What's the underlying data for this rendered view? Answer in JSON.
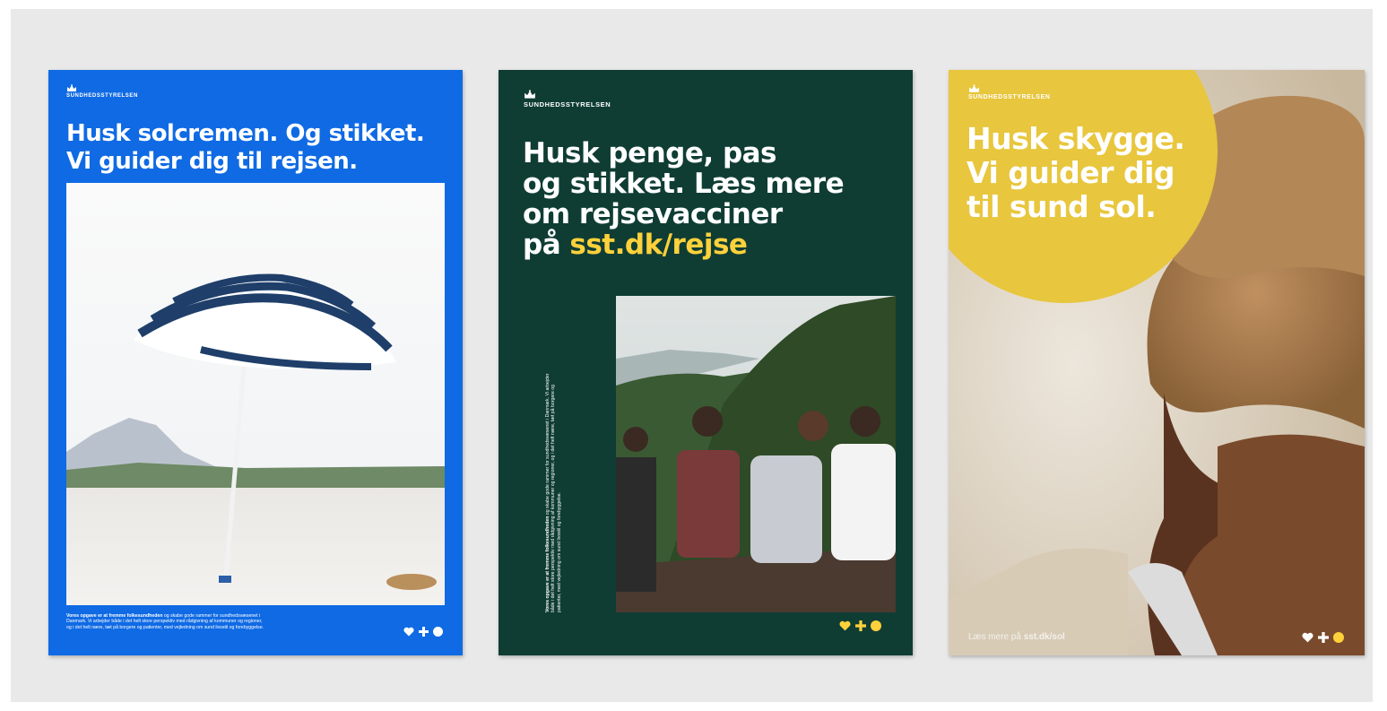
{
  "brand": {
    "name": "SUNDHEDSSTYRELSEN"
  },
  "colors": {
    "stage_bg": "#e9e9e9",
    "poster1_bg": "#0f6ae4",
    "poster2_bg": "#0f3d34",
    "accent_yellow": "#ffd13b",
    "sun_circle": "#e8c63d"
  },
  "posters": [
    {
      "headline": [
        "Husk solcremen. Og stikket.",
        "Vi guider dig til rejsen."
      ],
      "photo": "beach-umbrella-photo",
      "footer_bold": "Vores opgave er at fremme folkesundheden",
      "footer_rest": " og skabe gode rammer for sundhedsvæsenet i Danmark. Vi arbejder både i det helt store perspektiv med rådgivning af kommuner og regioner, og i det helt nære, tæt på borgere og patienter, med vejledning om sund livsstil og forebyggelse.",
      "symbols": [
        "heart-icon",
        "plus-icon",
        "circle-icon"
      ]
    },
    {
      "headline": [
        "Husk penge, pas",
        "og stikket. Læs mere",
        "om rejsevacciner",
        "på "
      ],
      "headline_accent": "sst.dk/rejse",
      "photo": "friends-on-hill-photo",
      "footer_bold": "Vores opgave er at fremme folkesundheden",
      "footer_rest": " og skabe gode rammer for sundhedsvæsenet i Danmark. Vi arbejder både i det helt store perspektiv med rådgivning af kommuner og regioner, og i det helt nære, tæt på borgere og patienter, med vejledning om sund livsstil og forebyggelse.",
      "symbols": [
        "heart-icon",
        "plus-icon",
        "circle-icon"
      ]
    },
    {
      "headline": [
        "Husk skygge.",
        "Vi guider dig",
        "til sund sol."
      ],
      "photo": "woman-straw-hat-photo",
      "footer_prefix": "Læs mere på ",
      "footer_link": "sst.dk/sol",
      "symbols": [
        "heart-icon",
        "plus-icon",
        "circle-icon"
      ]
    }
  ]
}
